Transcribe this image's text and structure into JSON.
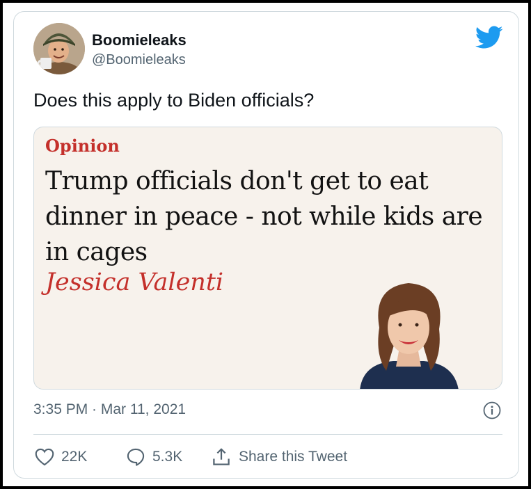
{
  "author": {
    "name": "Boomieleaks",
    "handle": "@Boomieleaks",
    "avatar_icon": "avatar-soldier-with-mug"
  },
  "platform_icon": "twitter-bird-icon",
  "brand_color": "#1d9bf0",
  "tweet": {
    "text": "Does this apply to Biden officials?",
    "timestamp": "3:35 PM · Mar 11, 2021"
  },
  "card": {
    "label": "Opinion",
    "headline": "Trump officials don't get to eat dinner in peace - not while kids are in cages",
    "author": "Jessica Valenti",
    "accent_color": "#c4302b",
    "background": "#f7f2ec"
  },
  "actions": {
    "like_count": "22K",
    "reply_count": "5.3K",
    "share_label": "Share this Tweet"
  }
}
